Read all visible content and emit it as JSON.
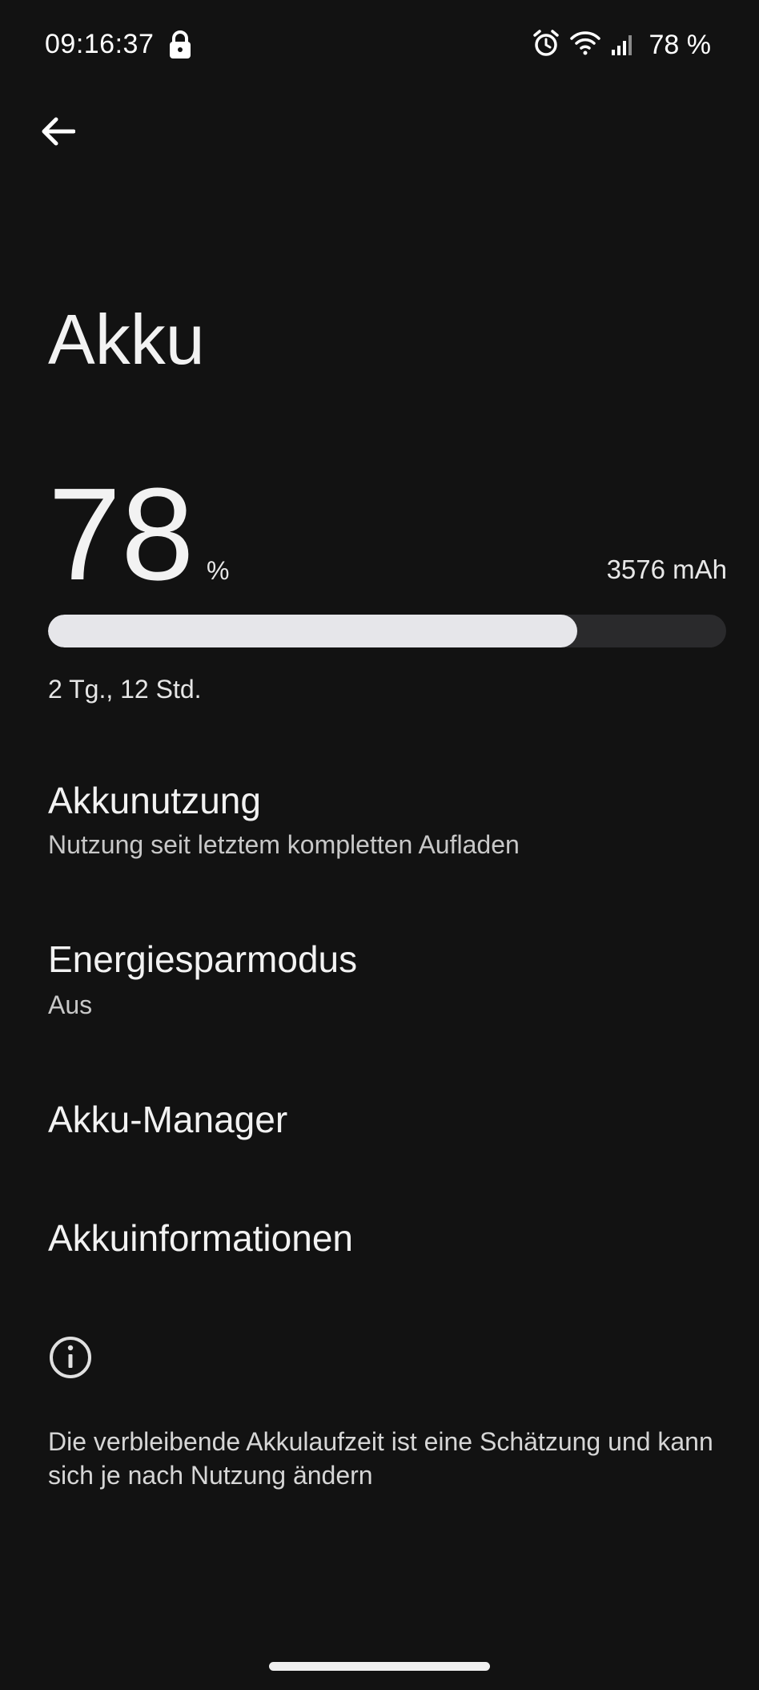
{
  "status_bar": {
    "time": "09:16:37",
    "battery_text": "78 %",
    "icons": [
      "lock-icon",
      "alarm-icon",
      "wifi-icon",
      "signal-icon"
    ]
  },
  "header": {
    "back_icon": "arrow-left-icon",
    "title": "Akku"
  },
  "battery": {
    "level": "78",
    "percent_sign": "%",
    "capacity": "3576 mAh",
    "fill_fraction": 0.78,
    "remaining": "2 Tg., 12 Std."
  },
  "menu": {
    "items": [
      {
        "title": "Akkunutzung",
        "subtitle": "Nutzung seit letztem kompletten Aufladen"
      },
      {
        "title": "Energiesparmodus",
        "subtitle": "Aus"
      },
      {
        "title": "Akku-Manager"
      },
      {
        "title": "Akkuinformationen"
      }
    ]
  },
  "info": {
    "icon": "info-icon",
    "text": "Die verbleibende Akkulaufzeit ist eine Schätzung und kann sich je nach Nutzung ändern"
  },
  "colors": {
    "background": "#121212",
    "progress_fill": "#e6e6ea",
    "progress_track": "#2a2a2c"
  }
}
